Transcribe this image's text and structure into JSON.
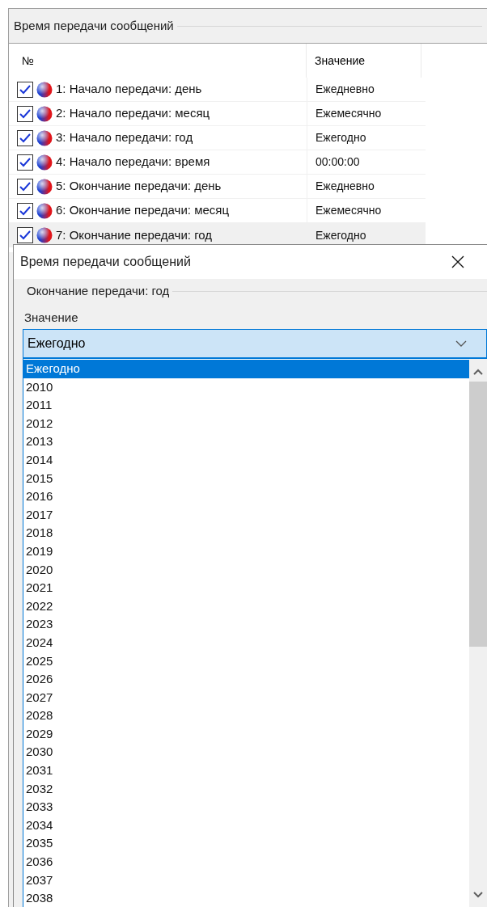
{
  "panel": {
    "title": "Время передачи сообщений"
  },
  "table": {
    "columns": [
      "№",
      "Значение"
    ],
    "rows": [
      {
        "checked": true,
        "label": "1: Начало передачи: день",
        "value": "Ежедневно",
        "selected": false
      },
      {
        "checked": true,
        "label": "2: Начало передачи: месяц",
        "value": "Ежемесячно",
        "selected": false
      },
      {
        "checked": true,
        "label": "3: Начало передачи: год",
        "value": "Ежегодно",
        "selected": false
      },
      {
        "checked": true,
        "label": "4: Начало передачи: время",
        "value": "00:00:00",
        "selected": false
      },
      {
        "checked": true,
        "label": "5: Окончание передачи: день",
        "value": "Ежедневно",
        "selected": false
      },
      {
        "checked": true,
        "label": "6: Окончание передачи: месяц",
        "value": "Ежемесячно",
        "selected": false
      },
      {
        "checked": true,
        "label": "7: Окончание передачи: год",
        "value": "Ежегодно",
        "selected": true
      }
    ]
  },
  "dialog": {
    "title": "Время передачи сообщений",
    "group_title": "Окончание передачи: год",
    "field_label": "Значение",
    "combo_value": "Ежегодно",
    "options": [
      {
        "label": "Ежегодно",
        "selected": true
      },
      {
        "label": "2010",
        "selected": false
      },
      {
        "label": "2011",
        "selected": false
      },
      {
        "label": "2012",
        "selected": false
      },
      {
        "label": "2013",
        "selected": false
      },
      {
        "label": "2014",
        "selected": false
      },
      {
        "label": "2015",
        "selected": false
      },
      {
        "label": "2016",
        "selected": false
      },
      {
        "label": "2017",
        "selected": false
      },
      {
        "label": "2018",
        "selected": false
      },
      {
        "label": "2019",
        "selected": false
      },
      {
        "label": "2020",
        "selected": false
      },
      {
        "label": "2021",
        "selected": false
      },
      {
        "label": "2022",
        "selected": false
      },
      {
        "label": "2023",
        "selected": false
      },
      {
        "label": "2024",
        "selected": false
      },
      {
        "label": "2025",
        "selected": false
      },
      {
        "label": "2026",
        "selected": false
      },
      {
        "label": "2027",
        "selected": false
      },
      {
        "label": "2028",
        "selected": false
      },
      {
        "label": "2029",
        "selected": false
      },
      {
        "label": "2030",
        "selected": false
      },
      {
        "label": "2031",
        "selected": false
      },
      {
        "label": "2032",
        "selected": false
      },
      {
        "label": "2033",
        "selected": false
      },
      {
        "label": "2034",
        "selected": false
      },
      {
        "label": "2035",
        "selected": false
      },
      {
        "label": "2036",
        "selected": false
      },
      {
        "label": "2037",
        "selected": false
      },
      {
        "label": "2038",
        "selected": false
      }
    ]
  }
}
